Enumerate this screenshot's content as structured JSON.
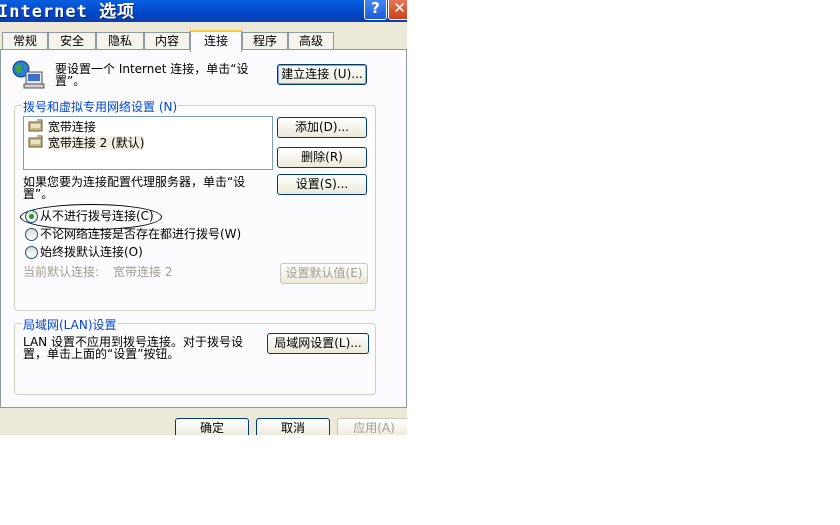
{
  "window": {
    "title": "Internet 选项",
    "help_glyph": "?",
    "close_glyph": "✕"
  },
  "tabs": [
    {
      "label": "常规"
    },
    {
      "label": "安全"
    },
    {
      "label": "隐私"
    },
    {
      "label": "内容"
    },
    {
      "label": "连接"
    },
    {
      "label": "程序"
    },
    {
      "label": "高级"
    }
  ],
  "active_tab": "连接",
  "setup": {
    "text_line1": "要设置一个 Internet 连接，单击“设",
    "text_line2": "置”。",
    "button": "建立连接 (U)..."
  },
  "dialup": {
    "group_label": "拨号和虚拟专用网络设置 (N)",
    "connections": [
      {
        "label": "宽带连接"
      },
      {
        "label": "宽带连接 2 (默认)"
      }
    ],
    "add_button": "添加(D)...",
    "remove_button": "删除(R)",
    "settings_button": "设置(S)...",
    "proxy_text_line1": "如果您要为连接配置代理服务器，单击“设",
    "proxy_text_line2": "置”。",
    "radio_options": [
      {
        "label": "从不进行拨号连接(C)",
        "checked": true
      },
      {
        "label": "不论网络连接是否存在都进行拨号(W)",
        "checked": false
      },
      {
        "label": "始终拨默认连接(O)",
        "checked": false
      }
    ],
    "current_default_label": "当前默认连接:",
    "current_default_value": "宽带连接 2",
    "set_default_button": "设置默认值(E)"
  },
  "lan": {
    "group_label": "局域网(LAN)设置",
    "text_line1": "LAN 设置不应用到拨号连接。对于拨号设",
    "text_line2": "置，单击上面的“设置”按钮。",
    "button": "局域网设置(L)..."
  },
  "footer": {
    "ok_button": "确定",
    "cancel_button": "取消",
    "apply_button": "应用(A)"
  }
}
